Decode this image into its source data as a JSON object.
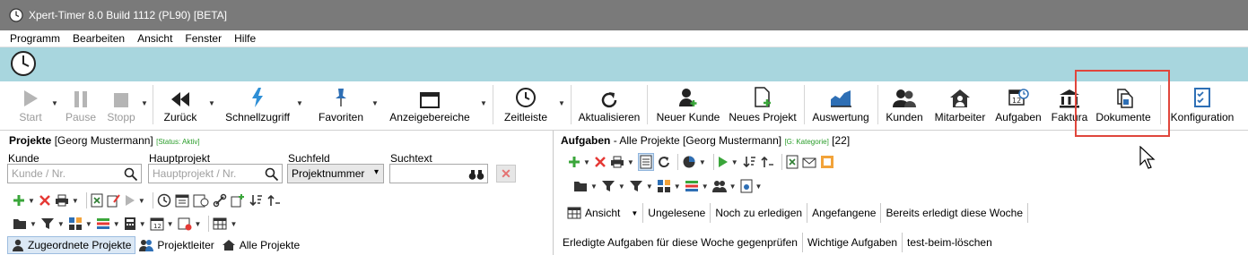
{
  "window": {
    "title": "Xpert-Timer 8.0 Build 1112 (PL90) [BETA]"
  },
  "menu": [
    "Programm",
    "Bearbeiten",
    "Ansicht",
    "Fenster",
    "Hilfe"
  ],
  "toolbar": {
    "start": "Start",
    "pause": "Pause",
    "stopp": "Stopp",
    "zurueck": "Zurück",
    "schnellzugriff": "Schnellzugriff",
    "favoriten": "Favoriten",
    "anzeigebereiche": "Anzeigebereiche",
    "zeitleiste": "Zeitleiste",
    "aktualisieren": "Aktualisieren",
    "neuer_kunde": "Neuer Kunde",
    "neues_projekt": "Neues Projekt",
    "auswertung": "Auswertung",
    "kunden": "Kunden",
    "mitarbeiter": "Mitarbeiter",
    "aufgaben": "Aufgaben",
    "faktura": "Faktura",
    "dokumente": "Dokumente",
    "konfiguration": "Konfiguration"
  },
  "left": {
    "title": "Projekte",
    "user": "[Georg Mustermann]",
    "status": "[Status: Aktiv]",
    "kunde_label": "Kunde",
    "kunde_placeholder": "Kunde / Nr.",
    "haupt_label": "Hauptprojekt",
    "haupt_placeholder": "Hauptprojekt / Nr.",
    "suchfeld_label": "Suchfeld",
    "suchfeld_value": "Projektnummer",
    "suchtext_label": "Suchtext",
    "tabs": [
      "Zugeordnete Projekte",
      "Projektleiter",
      "Alle Projekte"
    ]
  },
  "right": {
    "title": "Aufgaben",
    "subtitle": "- Alle Projekte [Georg Mustermann]",
    "kategorie": "[G: Kategorie]",
    "count": "[22]",
    "views": [
      "Ansicht",
      "Ungelesene",
      "Noch zu erledigen",
      "Angefangene",
      "Bereits erledigt diese Woche"
    ],
    "filters": [
      "Erledigte Aufgaben für diese Woche gegenprüfen",
      "Wichtige Aufgaben",
      "test-beim-löschen"
    ]
  }
}
